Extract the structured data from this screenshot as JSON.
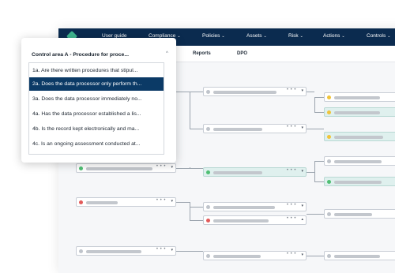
{
  "nav": {
    "items": [
      {
        "label": "User guide",
        "has_chevron": false
      },
      {
        "label": "Compliance",
        "has_chevron": true
      },
      {
        "label": "Policies",
        "has_chevron": true
      },
      {
        "label": "Assets",
        "has_chevron": true
      },
      {
        "label": "Risk",
        "has_chevron": true
      },
      {
        "label": "Actions",
        "has_chevron": true
      },
      {
        "label": "Controls",
        "has_chevron": true
      }
    ]
  },
  "subtabs": {
    "items": [
      {
        "label": "Reports"
      },
      {
        "label": "DPO"
      }
    ]
  },
  "node_menu": "• • •",
  "caret_down": "▾",
  "caret_up": "▴",
  "chevron_down": "⌄",
  "dropdown": {
    "selected_label": "Control area A - Procedure for proce...",
    "chevron": "^",
    "options": [
      {
        "label": "1a. Are there written procedures that stipul...",
        "selected": false
      },
      {
        "label": "2a. Does the data processor only perform th...",
        "selected": true
      },
      {
        "label": "3a. Does the data processor immediately no...",
        "selected": false
      },
      {
        "label": "4a. Has the data processor established a lis...",
        "selected": false
      },
      {
        "label": "4b. Is the record kept electronically and ma...",
        "selected": false
      },
      {
        "label": "4c. Is an ongoing assessment conducted at...",
        "selected": false
      }
    ]
  },
  "colors": {
    "nav_bg": "#0b2b4f",
    "selected_bg": "#0b3a66",
    "status_green": "#4fbf73",
    "status_red": "#e25a5a",
    "status_yellow": "#f0c43a",
    "highlight_node": "#dff0ee"
  }
}
